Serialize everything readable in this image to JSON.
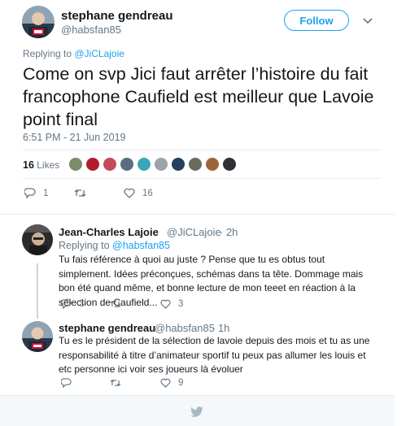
{
  "main_tweet": {
    "author_name": "stephane gendreau",
    "author_handle": "@habsfan85",
    "follow_label": "Follow",
    "replying_to_prefix": "Replying to ",
    "replying_to_handle": "@JiCLajoie",
    "text": "Come on svp Jici faut arrêter l’histoire du fait francophone Caufield est meilleur que Lavoie point final",
    "timestamp": "6:51 PM - 21 Jun 2019",
    "likes_count": "16",
    "likes_label": "Likes",
    "reply_count": "1",
    "retweet_count": "",
    "like_count": "16"
  },
  "replies": [
    {
      "author_name": "Jean-Charles Lajoie",
      "author_handle": "@JiCLajoie",
      "time": "· 2h",
      "replying_to_prefix": "Replying to ",
      "replying_to_handle": "@habsfan85",
      "text": "Tu fais référence à quoi au juste ? Pense que tu es obtus tout simplement. Idées préconçues, schémas dans ta tête. Dommage mais bon été quand même, et bonne lecture de mon teeet en réaction à la sélection de Caufield...",
      "reply_count": "3",
      "retweet_count": "",
      "like_count": "3"
    },
    {
      "author_name": "stephane gendreau",
      "author_handle": "@habsfan85",
      "time": "· 1h",
      "text": "Tu es le président de la sélection de lavoie depuis des mois et tu as une responsabilité à titre d’animateur sportif tu peux pas allumer les louis et etc personne ici voir ses joueurs là évoluer",
      "reply_count": "",
      "retweet_count": "",
      "like_count": "9"
    }
  ],
  "colors": {
    "accent": "#1da1f2",
    "secondary_text": "#657786",
    "divider": "#e6ecf0"
  },
  "icons": [
    "reply-icon",
    "retweet-icon",
    "like-icon",
    "chevron-down-icon",
    "twitter-bird-icon"
  ]
}
